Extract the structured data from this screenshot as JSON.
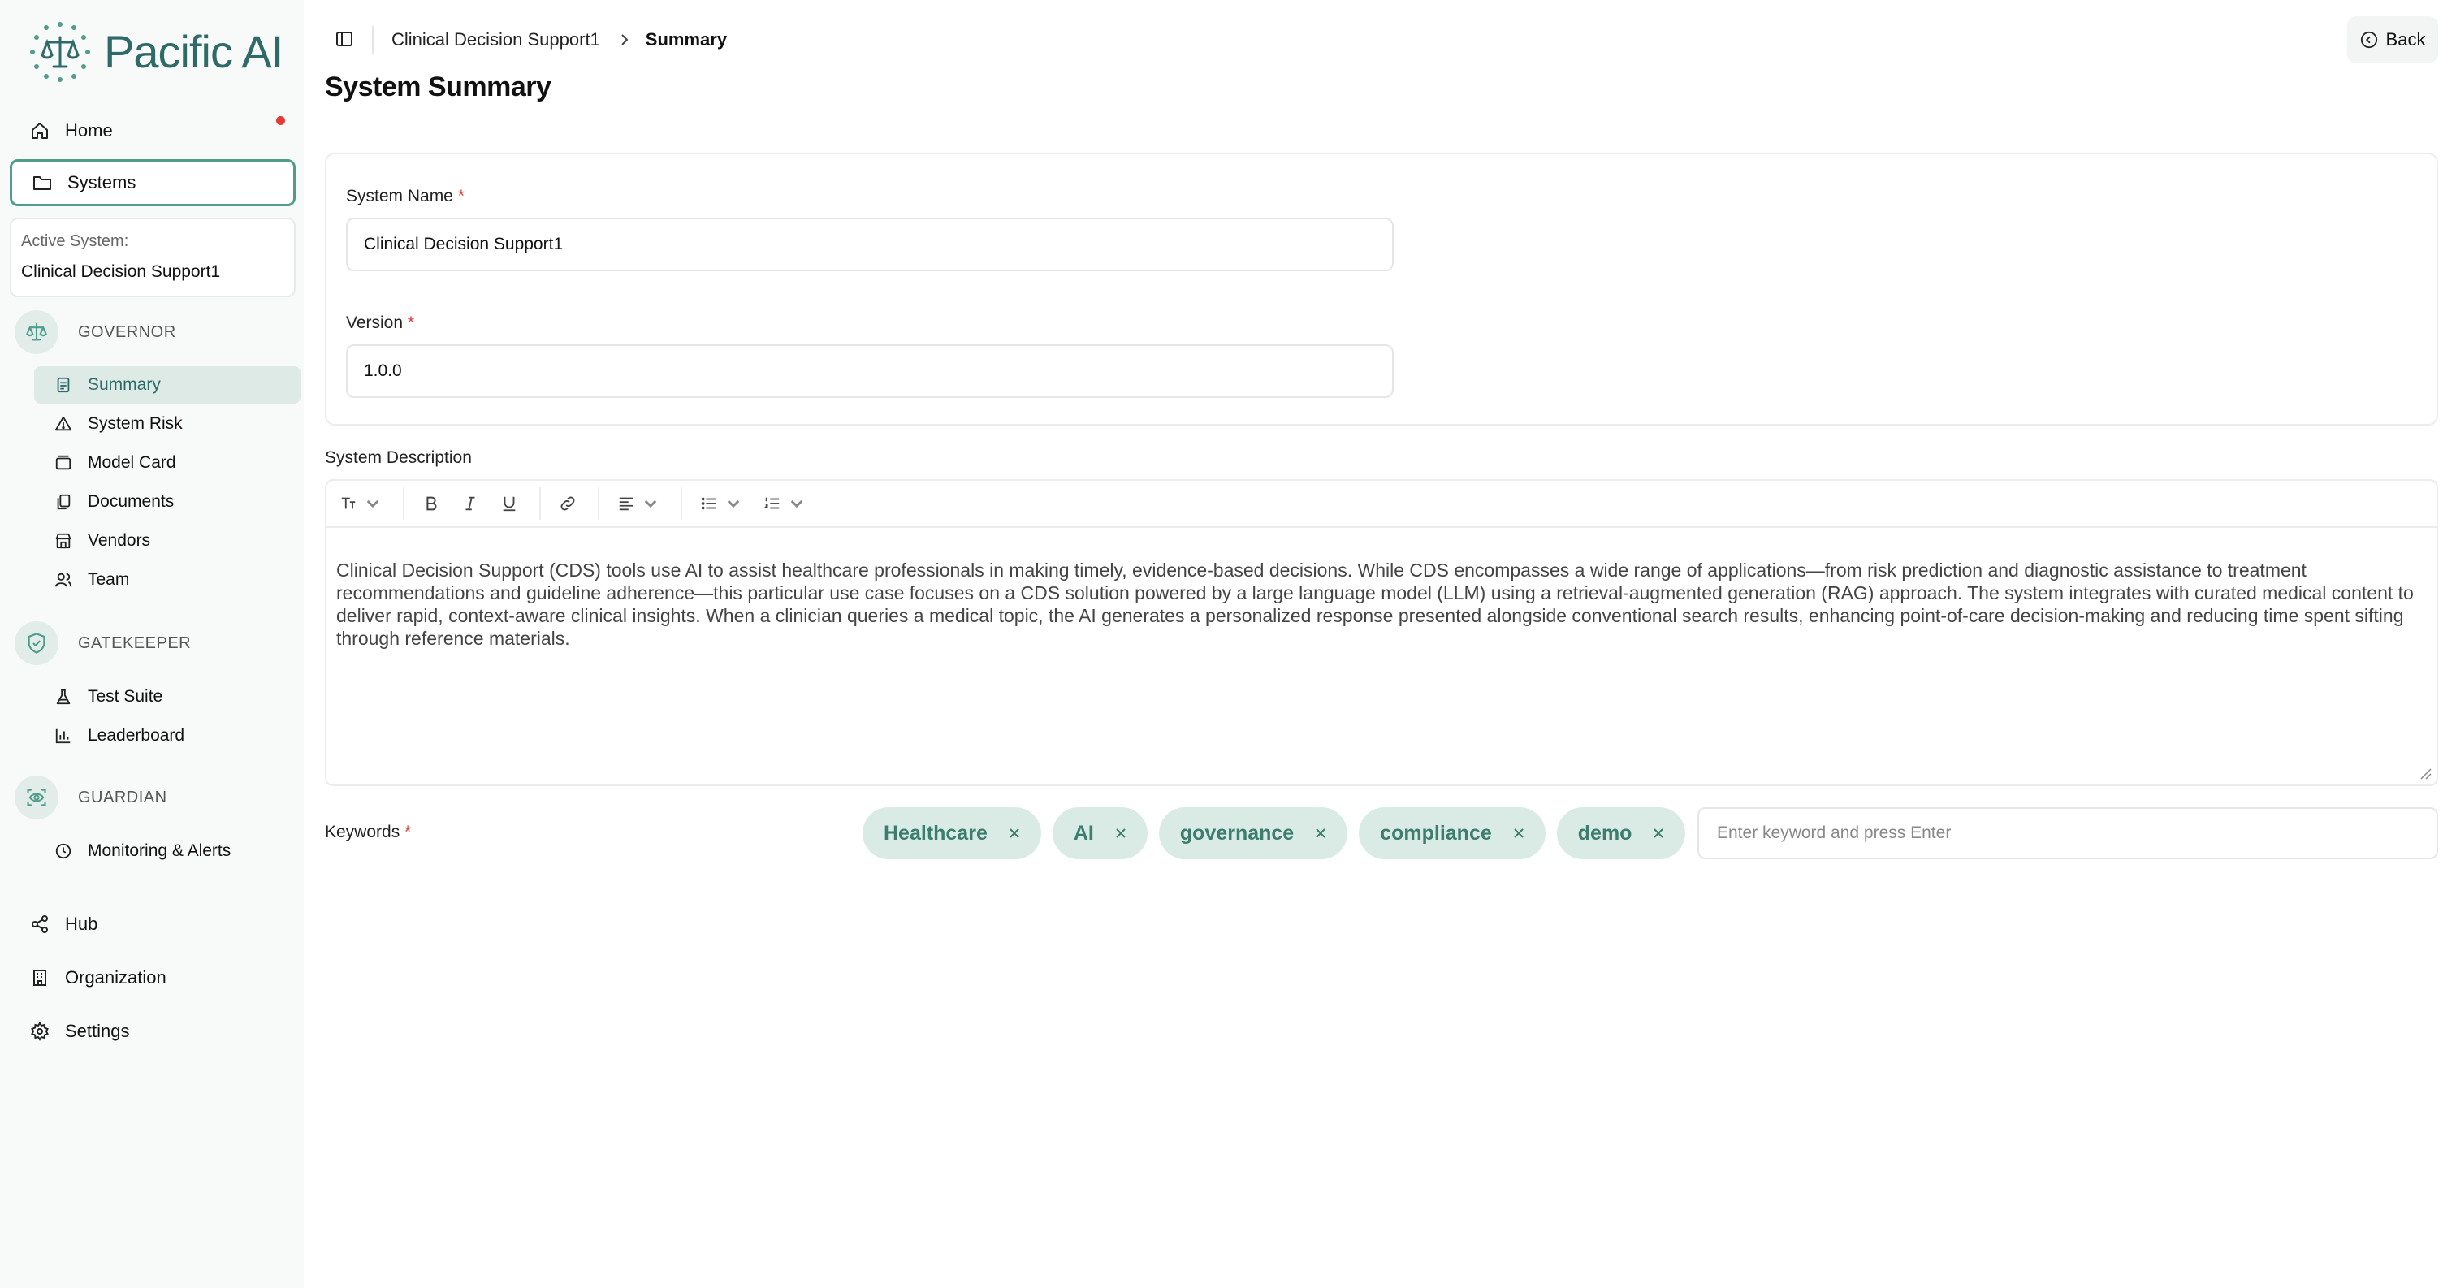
{
  "brand": {
    "name": "Pacific AI",
    "accent": "#4f9d8a",
    "accent_dark": "#2e6b68",
    "chip_bg": "#d9ebe4"
  },
  "sidebar": {
    "top_items": [
      {
        "label": "Home",
        "icon": "home-icon"
      },
      {
        "label": "Systems",
        "icon": "folder-icon"
      }
    ],
    "active_system": {
      "label": "Active System:",
      "value": "Clinical Decision Support1"
    },
    "governor": {
      "title": "GOVERNOR",
      "items": [
        {
          "label": "Summary",
          "icon": "document-icon"
        },
        {
          "label": "System Risk",
          "icon": "warning-icon"
        },
        {
          "label": "Model Card",
          "icon": "card-icon"
        },
        {
          "label": "Documents",
          "icon": "documents-icon"
        },
        {
          "label": "Vendors",
          "icon": "store-icon"
        },
        {
          "label": "Team",
          "icon": "users-icon"
        }
      ]
    },
    "gatekeeper": {
      "title": "GATEKEEPER",
      "items": [
        {
          "label": "Test Suite",
          "icon": "flask-icon"
        },
        {
          "label": "Leaderboard",
          "icon": "bar-chart-icon"
        }
      ]
    },
    "guardian": {
      "title": "GUARDIAN",
      "items": [
        {
          "label": "Monitoring & Alerts",
          "icon": "clock-icon"
        }
      ]
    },
    "bottom_items": [
      {
        "label": "Hub",
        "icon": "share-icon"
      },
      {
        "label": "Organization",
        "icon": "building-icon"
      },
      {
        "label": "Settings",
        "icon": "gear-icon"
      }
    ]
  },
  "header": {
    "breadcrumb": [
      "Clinical Decision Support1",
      "Summary"
    ],
    "back_label": "Back",
    "page_title": "System Summary"
  },
  "form": {
    "system_name": {
      "label": "System Name",
      "required": "*",
      "value": "Clinical Decision Support1"
    },
    "version": {
      "label": "Version",
      "required": "*",
      "value": "1.0.0"
    },
    "description": {
      "label": "System Description",
      "text": "Clinical Decision Support (CDS) tools use AI to assist healthcare professionals in making timely, evidence-based decisions. While CDS encompasses a wide range of applications—from risk prediction and diagnostic assistance to treatment recommendations and guideline adherence—this particular use case focuses on a CDS solution powered by a large language model (LLM) using a retrieval-augmented generation (RAG) approach. The system integrates with curated medical content to deliver rapid, context-aware clinical insights. When a clinician queries a medical topic, the AI generates a personalized response presented alongside conventional search results, enhancing point-of-care decision-making and reducing time spent sifting through reference materials."
    },
    "keywords": {
      "label": "Keywords",
      "required": "*",
      "chips": [
        "Healthcare",
        "AI",
        "governance",
        "compliance",
        "demo"
      ],
      "placeholder": "Enter keyword and press Enter"
    }
  }
}
